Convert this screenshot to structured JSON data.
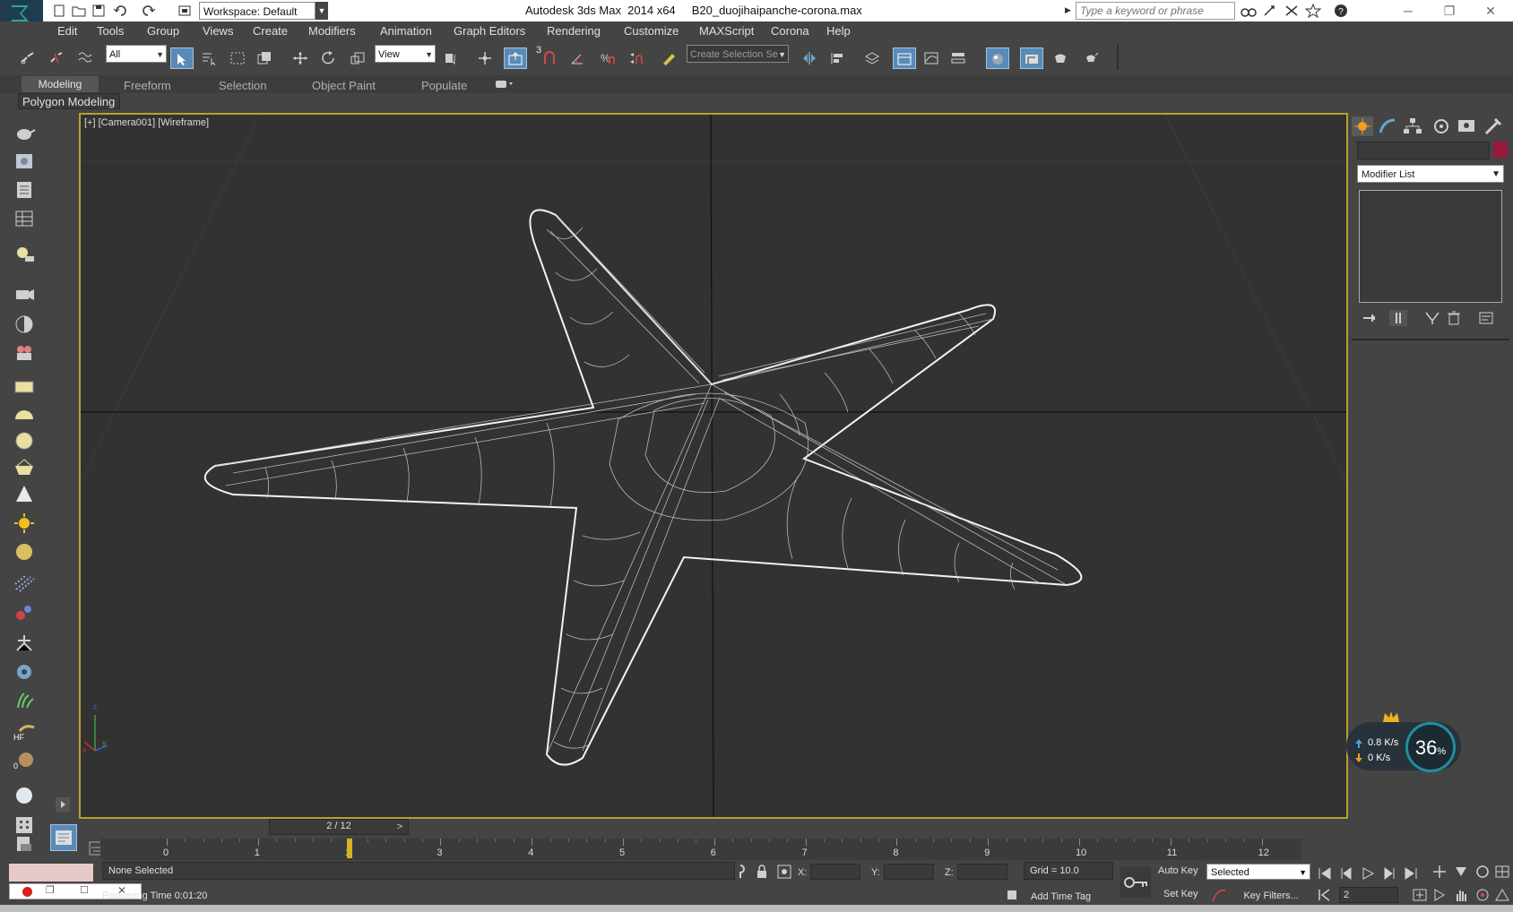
{
  "window": {
    "title": "Autodesk 3ds Max  2014 x64     B20_duojihaipanche-corona.max",
    "workspace": "Workspace: Default",
    "search_placeholder": "Type a keyword or phrase"
  },
  "menu": [
    "Edit",
    "Tools",
    "Group",
    "Views",
    "Create",
    "Modifiers",
    "Animation",
    "Graph Editors",
    "Rendering",
    "Customize",
    "MAXScript",
    "Corona",
    "Help"
  ],
  "toolbar": {
    "selection_filter": "All",
    "ref_coord": "View",
    "snap_number": "3",
    "named_selection": "Create Selection Se"
  },
  "ribbon": {
    "tabs": [
      "Modeling",
      "Freeform",
      "Selection",
      "Object Paint",
      "Populate"
    ],
    "active_tab": "Modeling",
    "sub_label": "Polygon Modeling"
  },
  "viewport": {
    "label": "[+] [Camera001] [Wireframe]",
    "border_color": "#b8a030",
    "background": "#323232",
    "axis_labels": [
      "z",
      "y",
      "x"
    ]
  },
  "command_panel": {
    "modifier_list": "Modifier List",
    "object_color": "#9a1a3c"
  },
  "net_meter": {
    "up": "0.8",
    "down": "0",
    "unit": "K/s",
    "percent": "36",
    "percent_sign": "%"
  },
  "timeline": {
    "slider_text": "2 / 12",
    "prev": "<",
    "next": ">",
    "ticks": [
      "0",
      "1",
      "2",
      "3",
      "4",
      "5",
      "6",
      "7",
      "8",
      "9",
      "10",
      "11",
      "12"
    ],
    "current_frame": 2
  },
  "status": {
    "selection": "None Selected",
    "prompt_prefix": "Rendering Time",
    "prompt_value": "0:01:20",
    "x_label": "X:",
    "y_label": "Y:",
    "z_label": "Z:",
    "grid": "Grid = 10.0",
    "add_time_tag": "Add Time Tag",
    "auto_key": "Auto Key",
    "set_key": "Set Key",
    "key_mode": "Selected",
    "key_filters": "Key Filters...",
    "frame": "2"
  }
}
